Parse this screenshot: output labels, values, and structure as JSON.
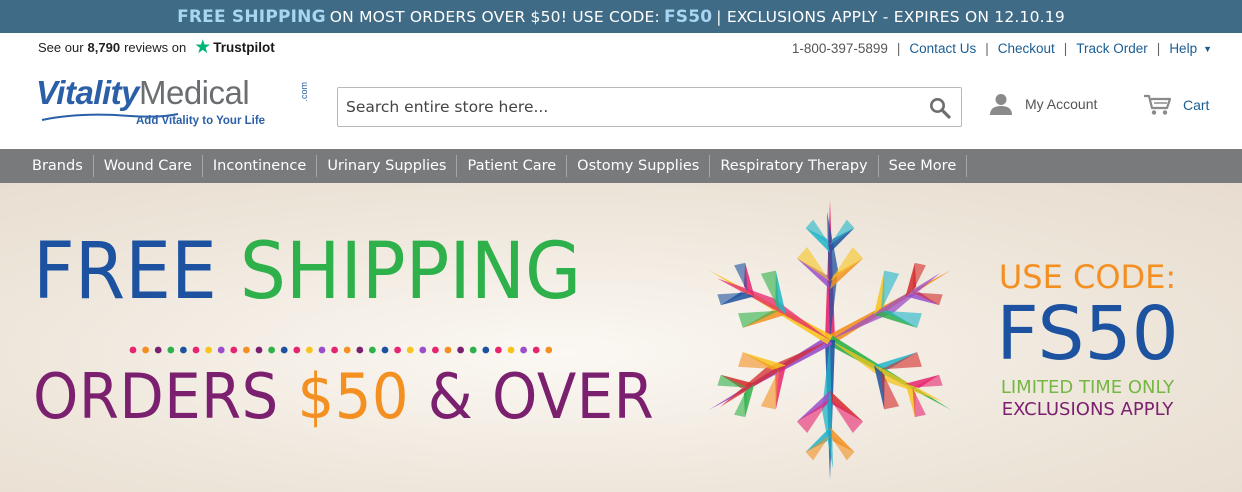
{
  "promo": {
    "part1": "FREE SHIPPING",
    "part2": "ON MOST ORDERS OVER $50! USE CODE:",
    "code": "FS50",
    "part3": "| EXCLUSIONS APPLY - EXPIRES ON 12.10.19"
  },
  "trustpilot": {
    "prefix": "See our",
    "count": "8,790",
    "suffix": "reviews on",
    "brand": "Trustpilot"
  },
  "utils": {
    "phone": "1-800-397-5899",
    "contact": "Contact Us",
    "checkout": "Checkout",
    "track": "Track Order",
    "help": "Help"
  },
  "logo": {
    "vitality": "Vitality",
    "medical": "Medical",
    "com": ".com",
    "tagline": "Add Vitality to Your Life"
  },
  "search": {
    "placeholder": "Search entire store here..."
  },
  "account": {
    "label": "My Account"
  },
  "cart": {
    "label": "Cart"
  },
  "nav": {
    "items": [
      "Brands",
      "Wound Care",
      "Incontinence",
      "Urinary Supplies",
      "Patient Care",
      "Ostomy Supplies",
      "Respiratory Therapy",
      "See More"
    ]
  },
  "banner": {
    "free": "FREE",
    "shipping": "SHIPPING",
    "orders": "ORDERS",
    "price": "$50",
    "over": "& OVER",
    "use_code": "USE CODE:",
    "code": "FS50",
    "limited": "LIMITED TIME ONLY",
    "exclusions": "EXCLUSIONS APPLY"
  },
  "colors": {
    "promo_bg": "#3f6b86",
    "nav_bg": "#787a7c",
    "link": "#1b5d92",
    "blue": "#1d52a0",
    "green": "#2eb04a",
    "purple": "#7b1f6f",
    "orange": "#f39021"
  }
}
